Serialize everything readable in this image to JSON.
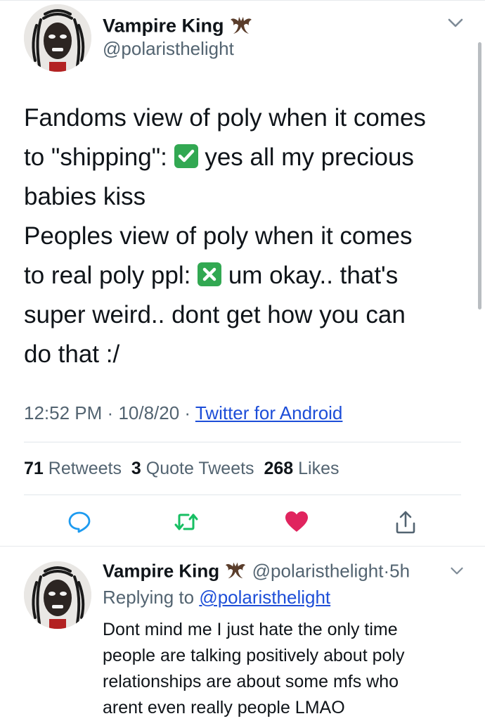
{
  "main_tweet": {
    "display_name": "Vampire King",
    "name_icon": "bat-emoji",
    "handle": "@polaristhelight",
    "text_lines": [
      {
        "before": "Fandoms view of poly when it comes",
        "after": ""
      },
      {
        "before": "to \"shipping\": ",
        "emoji": "check-mark-button-emoji",
        "after": " yes all my precious"
      },
      {
        "before": "babies kiss",
        "after": ""
      },
      {
        "before": "Peoples view of poly when it comes",
        "after": ""
      },
      {
        "before": "to real poly ppl: ",
        "emoji": "cross-mark-button-emoji",
        "after": " um okay.. that's"
      },
      {
        "before": "super weird.. dont get how you can",
        "after": ""
      },
      {
        "before": "do that :/",
        "after": ""
      }
    ],
    "time": "12:52 PM",
    "date": "10/8/20",
    "separator": "·",
    "source": "Twitter for Android",
    "stats": {
      "retweets_count": "71",
      "retweets_label": "Retweets",
      "quotes_count": "3",
      "quotes_label": "Quote Tweets",
      "likes_count": "268",
      "likes_label": "Likes"
    },
    "actions": {
      "reply_icon": "reply-icon",
      "retweet_icon": "retweet-icon",
      "like_icon": "heart-icon-filled",
      "share_icon": "share-icon"
    }
  },
  "reply_tweet": {
    "display_name": "Vampire King",
    "handle": "@polaristhelight",
    "separator": "·",
    "age": "5h",
    "replying_label": "Replying to",
    "replying_handle": "@polaristhelight",
    "text_lines": [
      "Dont mind me I just hate the only time",
      "people are talking positively about poly",
      "relationships are about some mfs who",
      "arent even really people LMAO"
    ]
  },
  "colors": {
    "like_red": "#e0245e",
    "retweet_green": "#17bf63",
    "check_green": "#32a852",
    "link_blue": "#1d4ed8"
  }
}
